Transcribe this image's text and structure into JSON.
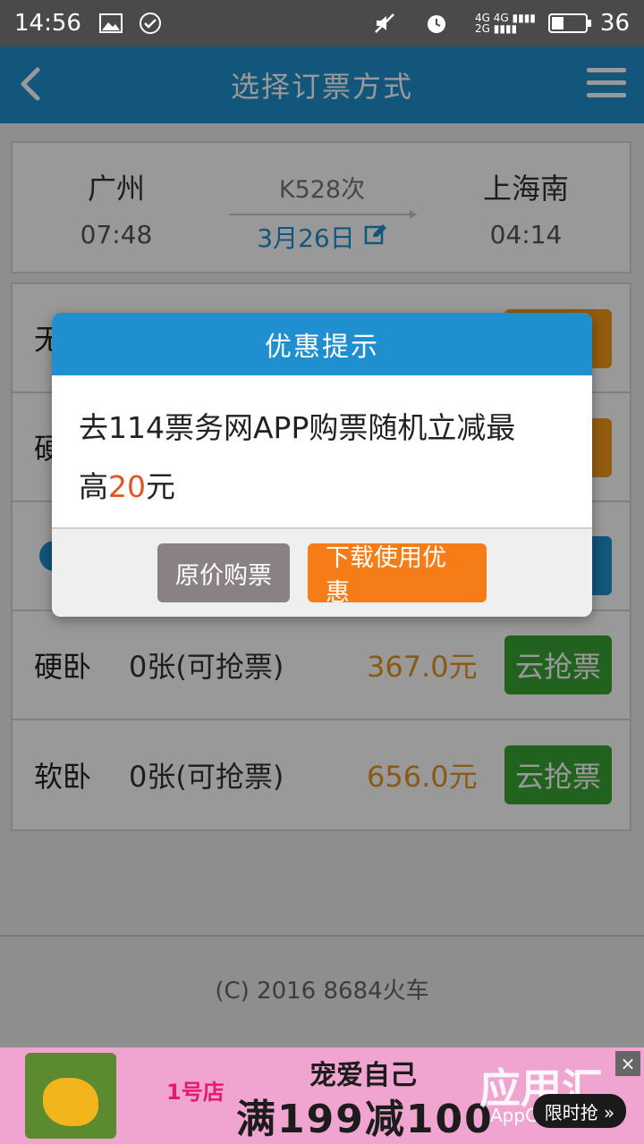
{
  "status_bar": {
    "time": "14:56",
    "network_label_top": "4G 4G",
    "network_label_bottom": "2G",
    "battery_level": "36",
    "battery_fraction": 0.36
  },
  "header": {
    "title": "选择订票方式",
    "back_icon": "chevron-left-icon",
    "menu_icon": "hamburger-menu-icon"
  },
  "train": {
    "from_station": "广州",
    "from_time": "07:48",
    "train_no": "K528次",
    "date": "3月26日",
    "to_station": "上海南",
    "to_time": "04:14"
  },
  "seats": [
    {
      "type": "无",
      "count": "",
      "price": "",
      "button": ""
    },
    {
      "type": "硬",
      "count": "",
      "price": "",
      "button": ""
    },
    {
      "type": "",
      "count": "",
      "price": "",
      "button": ""
    },
    {
      "type": "硬卧",
      "count": "0张(可抢票)",
      "price": "367.0元",
      "button": "云抢票"
    },
    {
      "type": "软卧",
      "count": "0张(可抢票)",
      "price": "656.0元",
      "button": "云抢票"
    }
  ],
  "footer": {
    "copyright": "(C) 2016 8684火车"
  },
  "dialog": {
    "title": "优惠提示",
    "body_line1": "去114票务网APP购票随机立减最",
    "body_line2_prefix": "高",
    "body_highlight": "20",
    "body_line2_suffix": "元",
    "btn_original": "原价购票",
    "btn_download": "下载使用优惠"
  },
  "ad": {
    "logo": "1号店",
    "slogan": "宠爱自己",
    "main": "满199减100",
    "brand": "应用汇",
    "sub": "AppChina.com",
    "badge": "限时抢 »",
    "close": "×"
  },
  "colors": {
    "primary": "#1f8fcf",
    "orange": "#f57c16",
    "green": "#3aa335",
    "price": "#e69424"
  }
}
